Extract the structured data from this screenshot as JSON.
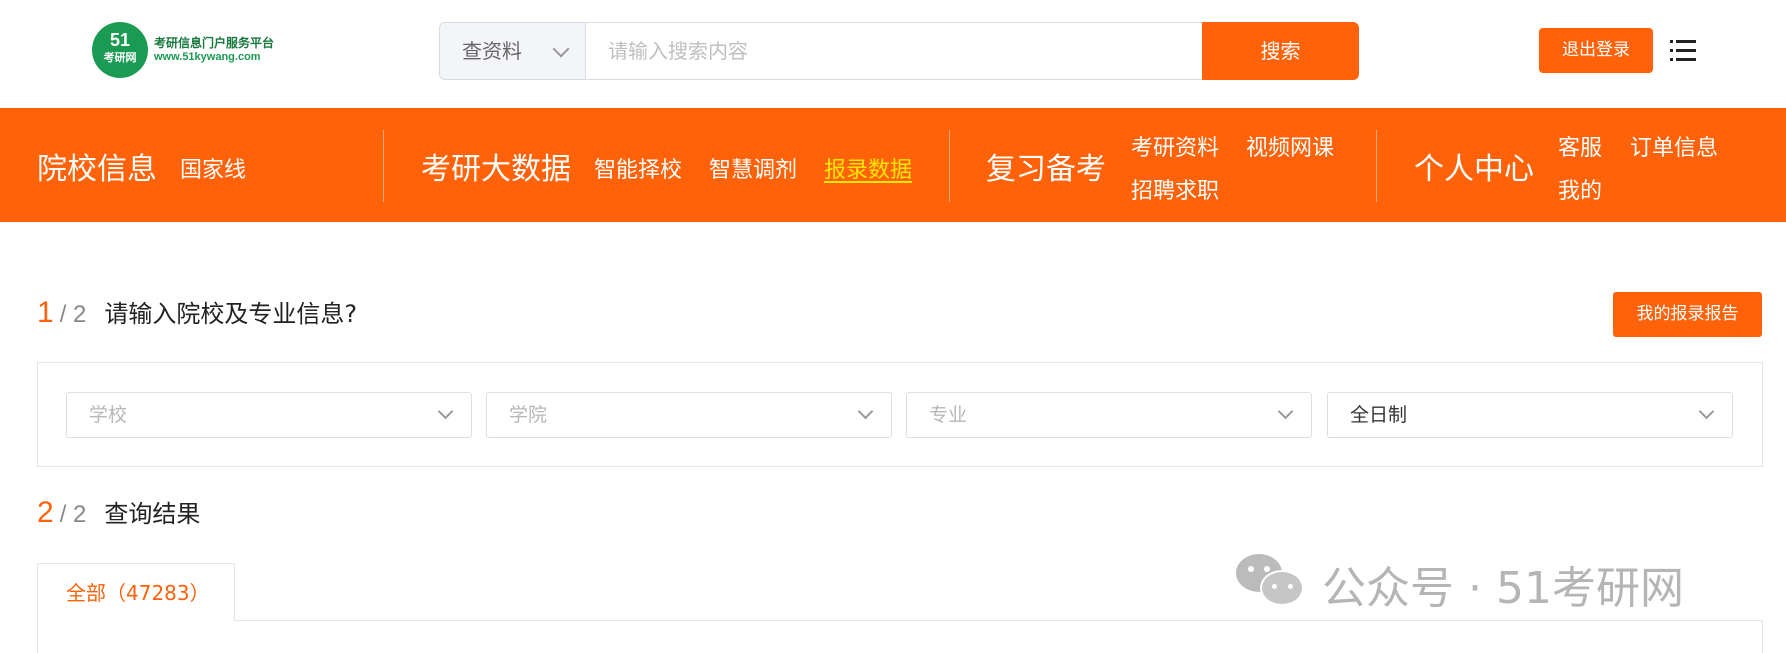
{
  "header": {
    "logo": {
      "number": "51",
      "name": "考研网",
      "tagline": "考研信息门户服务平台",
      "domain": "www.51kywang.com"
    },
    "search": {
      "type_selected": "查资料",
      "placeholder": "请输入搜索内容",
      "button_label": "搜索"
    },
    "logout_label": "退出登录",
    "menu_icon": "menu-list-icon"
  },
  "nav": {
    "groups": [
      {
        "title": "院校信息",
        "links": [
          "国家线"
        ]
      },
      {
        "title": "考研大数据",
        "links": [
          "智能择校",
          "智慧调剂",
          "报录数据"
        ],
        "active": "报录数据"
      },
      {
        "title": "复习备考",
        "links": [
          "考研资料",
          "视频网课",
          "招聘求职"
        ]
      },
      {
        "title": "个人中心",
        "links": [
          "客服",
          "订单信息",
          "我的"
        ]
      }
    ]
  },
  "step1": {
    "num": "1",
    "total": "/ 2",
    "label": "请输入院校及专业信息?",
    "report_button": "我的报录报告"
  },
  "filters": [
    {
      "placeholder": "学校",
      "value": ""
    },
    {
      "placeholder": "学院",
      "value": ""
    },
    {
      "placeholder": "专业",
      "value": ""
    },
    {
      "placeholder": "",
      "value": "全日制"
    }
  ],
  "step2": {
    "num": "2",
    "total": "/ 2",
    "label": "查询结果"
  },
  "tabs": [
    {
      "label": "全部（47283）",
      "active": true
    }
  ],
  "watermark": {
    "text": "公众号 · 51考研网",
    "icon": "wechat-icon"
  },
  "colors": {
    "accent": "#ff6209",
    "active_link": "#ffe600",
    "logo_green": "#1a9a52"
  }
}
